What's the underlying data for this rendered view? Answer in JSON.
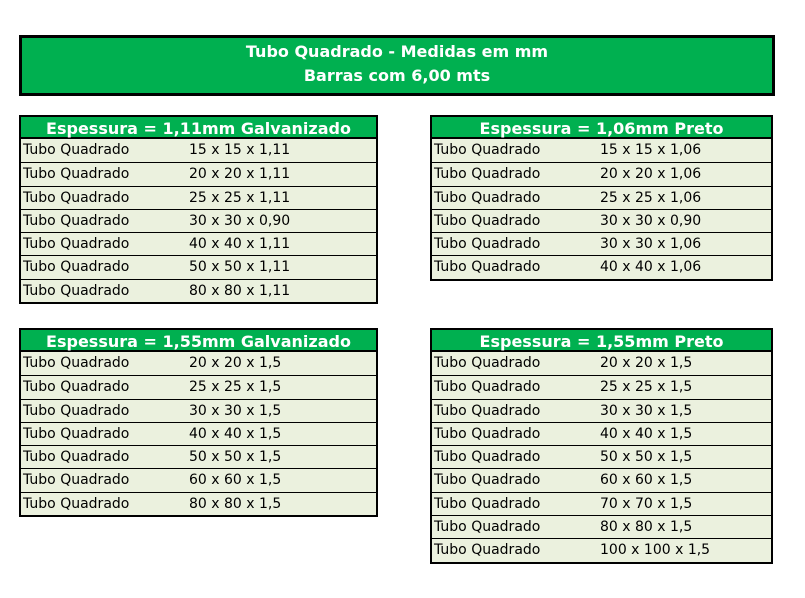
{
  "title": {
    "line1": "Tubo Quadrado - Medidas em mm",
    "line2": "Barras com 6,00 mts"
  },
  "tables": [
    {
      "header": "Espessura = 1,11mm Galvanizado",
      "rows": [
        {
          "name": "Tubo Quadrado",
          "size": "15 x 15 x 1,11"
        },
        {
          "name": "Tubo Quadrado",
          "size": "20 x 20 x 1,11"
        },
        {
          "name": "Tubo Quadrado",
          "size": "25 x 25 x 1,11"
        },
        {
          "name": "Tubo Quadrado",
          "size": "30 x 30 x 0,90"
        },
        {
          "name": "Tubo Quadrado",
          "size": "40 x 40 x 1,11"
        },
        {
          "name": "Tubo Quadrado",
          "size": "50 x 50 x 1,11"
        },
        {
          "name": "Tubo Quadrado",
          "size": "80 x 80 x 1,11"
        }
      ]
    },
    {
      "header": "Espessura = 1,06mm Preto",
      "rows": [
        {
          "name": "Tubo Quadrado",
          "size": "15 x 15 x 1,06"
        },
        {
          "name": "Tubo Quadrado",
          "size": "20 x 20 x 1,06"
        },
        {
          "name": "Tubo Quadrado",
          "size": "25 x 25 x 1,06"
        },
        {
          "name": "Tubo Quadrado",
          "size": "30 x 30 x 0,90"
        },
        {
          "name": "Tubo Quadrado",
          "size": "30 x 30 x 1,06"
        },
        {
          "name": "Tubo Quadrado",
          "size": "40 x 40 x 1,06"
        }
      ]
    },
    {
      "header": "Espessura = 1,55mm Galvanizado",
      "rows": [
        {
          "name": "Tubo Quadrado",
          "size": "20 x 20 x 1,5"
        },
        {
          "name": "Tubo Quadrado",
          "size": "25 x 25 x 1,5"
        },
        {
          "name": "Tubo Quadrado",
          "size": "30 x 30 x 1,5"
        },
        {
          "name": "Tubo Quadrado",
          "size": "40 x 40 x 1,5"
        },
        {
          "name": "Tubo Quadrado",
          "size": "50 x 50 x 1,5"
        },
        {
          "name": "Tubo Quadrado",
          "size": "60 x 60 x 1,5"
        },
        {
          "name": "Tubo Quadrado",
          "size": "80 x 80 x 1,5"
        }
      ]
    },
    {
      "header": "Espessura = 1,55mm Preto",
      "rows": [
        {
          "name": "Tubo Quadrado",
          "size": "20 x 20 x 1,5"
        },
        {
          "name": "Tubo Quadrado",
          "size": "25 x 25 x 1,5"
        },
        {
          "name": "Tubo Quadrado",
          "size": "30 x 30 x 1,5"
        },
        {
          "name": "Tubo Quadrado",
          "size": "40 x 40 x 1,5"
        },
        {
          "name": "Tubo Quadrado",
          "size": "50 x 50 x 1,5"
        },
        {
          "name": "Tubo Quadrado",
          "size": "60 x 60 x 1,5"
        },
        {
          "name": "Tubo Quadrado",
          "size": "70 x 70 x 1,5"
        },
        {
          "name": "Tubo Quadrado",
          "size": "80 x 80 x 1,5"
        },
        {
          "name": "Tubo Quadrado",
          "size": "100 x 100 x 1,5"
        }
      ]
    }
  ],
  "colors": {
    "header_green": "#00b050",
    "row_background": "#ebf1de",
    "border": "#000000",
    "header_text": "#ffffff"
  }
}
